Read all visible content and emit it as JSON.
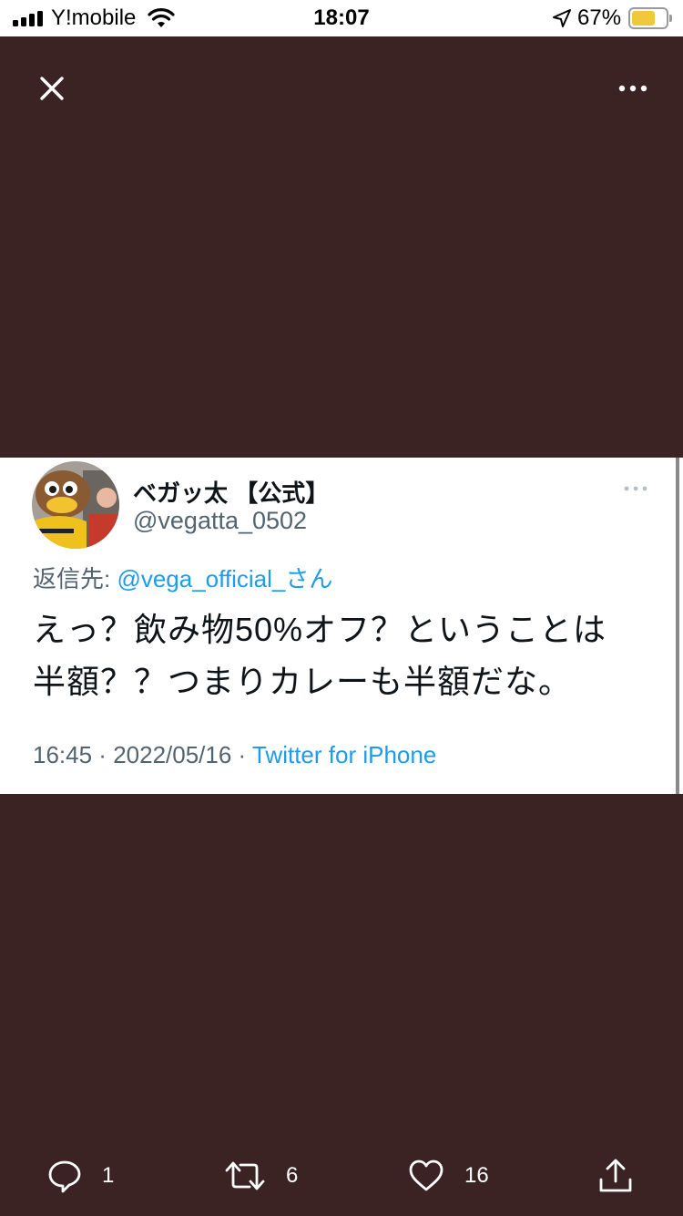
{
  "status_bar": {
    "carrier": "Y!mobile",
    "time": "18:07",
    "battery_percent": "67%",
    "battery_level": 0.67,
    "icons": [
      "signal-icon",
      "wifi-icon",
      "location-arrow-icon",
      "battery-icon"
    ]
  },
  "viewer": {
    "background_color": "#3c2323",
    "close_icon": "close-icon",
    "more_icon": "more-horizontal-icon"
  },
  "tweet": {
    "display_name": "ベガッ太 【公式】",
    "handle": "@vegatta_0502",
    "reply_prefix": "返信先: ",
    "reply_mention": "@vega_official_さん",
    "text_line1": "えっ？飲み物50%オフ？ということは",
    "text_line2": "半額？？つまりカレーも半額だな。",
    "time": "16:45",
    "date": "2022/05/16",
    "separator": " · ",
    "source": "Twitter for iPhone",
    "more_icon": "more-horizontal-icon",
    "link_color": "#1d9bf0"
  },
  "actions": {
    "reply_count": "1",
    "retweet_count": "6",
    "like_count": "16",
    "icons": [
      "reply-icon",
      "retweet-icon",
      "like-icon",
      "share-icon"
    ]
  }
}
